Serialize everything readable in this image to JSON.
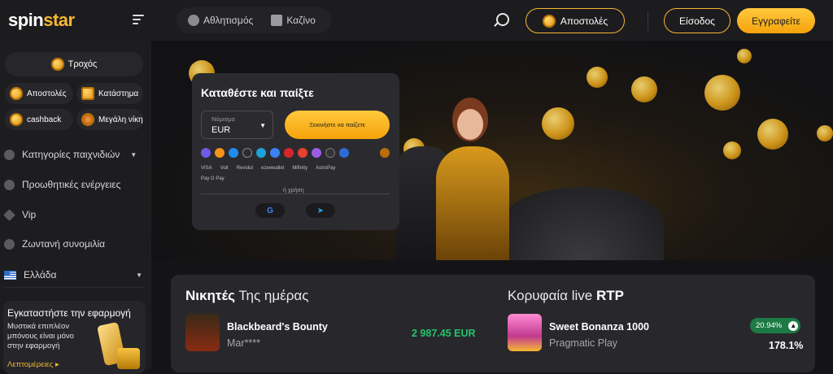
{
  "header": {
    "logo_first": "spin",
    "logo_second": "star",
    "nav": [
      {
        "label": "Αθλητισμός"
      },
      {
        "label": "Καζίνο"
      }
    ],
    "missions_label": "Αποστολές",
    "login_label": "Είσοδος",
    "register_label": "Εγγραφείτε"
  },
  "sidebar": {
    "wheel_label": "Τροχός",
    "pills": [
      {
        "label": "Αποστολές"
      },
      {
        "label": "Κατάστημα"
      },
      {
        "label": "cashback"
      },
      {
        "label": "Μεγάλη νίκη"
      }
    ],
    "menu": [
      {
        "label": "Κατηγορίες παιχνιδιών",
        "icon": "dice-icon"
      },
      {
        "label": "Προωθητικές ενέργειες",
        "icon": "gift-icon"
      },
      {
        "label": "Vip",
        "icon": "diamond-icon"
      },
      {
        "label": "Ζωντανή συνομιλία",
        "icon": "chat-icon"
      },
      {
        "label": "Ελλάδα",
        "icon": "greece-flag-icon"
      }
    ],
    "app": {
      "title": "Εγκαταστήστε την εφαρμογή",
      "desc": "Μυστικά επιπλέον μπόνους είναι μόνο στην εφαρμογή",
      "more": "Λεπτομέρειες ▸"
    }
  },
  "deposit": {
    "title": "Καταθέστε και παίξτε",
    "currency_label": "Νόμισμα",
    "currency_value": "EUR",
    "start_label": "Ξεκινήστε να παίζετε",
    "payments": [
      "VISA",
      "Volt",
      "Revolut",
      "ezeewallet",
      "Mifinity",
      "AstroPay"
    ],
    "payments2": "Pay  G Pay",
    "or_label": "ή χρήση",
    "social": [
      {
        "label": "G",
        "icon": "google-icon"
      },
      {
        "label": "➤",
        "icon": "telegram-icon"
      }
    ]
  },
  "winners": {
    "title_bold": "Νικητές",
    "title_rest": " Της ημέρας",
    "game": "Blackbeard's Bounty",
    "user": "Mar****",
    "amount": "2 987.45 EUR"
  },
  "rtp": {
    "title_rest": "Κορυφαία live ",
    "title_bold": "RTP",
    "game": "Sweet Bonanza 1000",
    "provider": "Pragmatic Play",
    "badge": "20.94%",
    "value": "178.1%"
  },
  "colors": {
    "accent": "#f7b731",
    "win": "#21c46a",
    "bg": "#16161a"
  }
}
